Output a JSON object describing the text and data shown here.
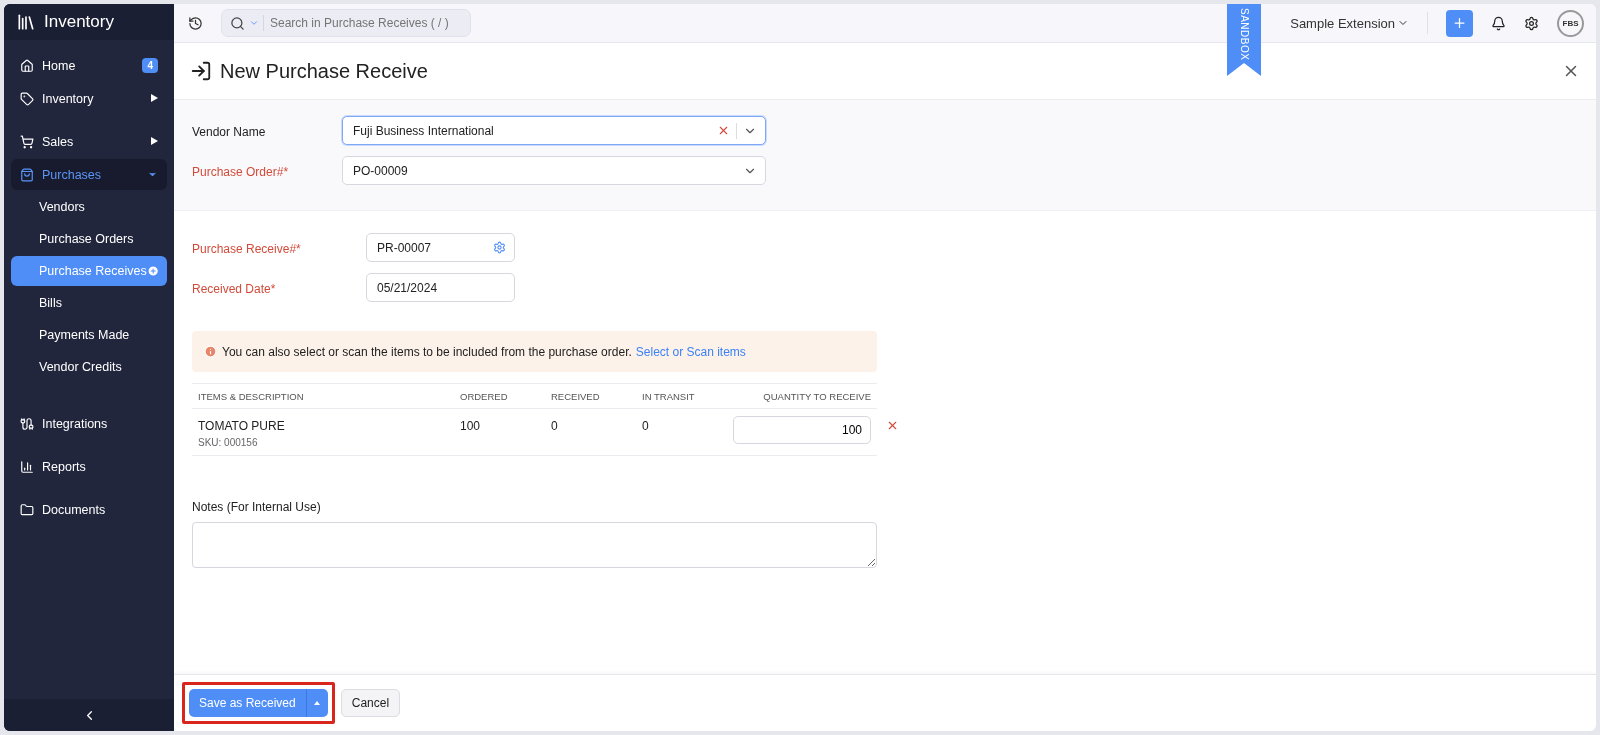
{
  "sidebar": {
    "brand": "Inventory",
    "sections": [
      {
        "items": [
          {
            "label": "Home",
            "badge": "4",
            "selected": false
          },
          {
            "label": "Inventory",
            "expanded": false,
            "selected": false
          }
        ]
      },
      {
        "items": [
          {
            "label": "Sales",
            "expanded": false,
            "selected": false
          },
          {
            "label": "Purchases",
            "expanded": true,
            "selected": true,
            "children": [
              {
                "label": "Vendors",
                "selected": false
              },
              {
                "label": "Purchase Orders",
                "selected": false
              },
              {
                "label": "Purchase Receives",
                "selected": true
              },
              {
                "label": "Bills",
                "selected": false
              },
              {
                "label": "Payments Made",
                "selected": false
              },
              {
                "label": "Vendor Credits",
                "selected": false
              }
            ]
          }
        ]
      },
      {
        "items": [
          {
            "label": "Integrations",
            "selected": false
          }
        ]
      },
      {
        "items": [
          {
            "label": "Reports",
            "selected": false
          }
        ]
      },
      {
        "items": [
          {
            "label": "Documents",
            "selected": false
          }
        ]
      }
    ]
  },
  "topbar": {
    "search": {
      "placeholder": "Search in Purchase Receives ( / )"
    },
    "ribbon": "SANDBOX",
    "organization": "Sample Extension",
    "avatar": "FBS"
  },
  "page": {
    "title": "New Purchase Receive"
  },
  "order_fields": [
    {
      "label": "Vendor Name",
      "value": "Fuji Business International",
      "required": false,
      "focused": true,
      "clearable": true
    },
    {
      "label": "Purchase Order#*",
      "value": "PO-00009",
      "required": true,
      "focused": false,
      "clearable": false
    }
  ],
  "receive_fields": [
    {
      "label": "Purchase Receive#*",
      "value": "PR-00007",
      "required": true,
      "kind": "settings"
    },
    {
      "label": "Received Date*",
      "value": "05/21/2024",
      "required": true,
      "kind": "plain"
    }
  ],
  "notice": {
    "text": "You can also select or scan the items to be included from the purchase order.",
    "link": "Select or Scan items"
  },
  "table": {
    "columns": [
      "ITEMS & DESCRIPTION",
      "ORDERED",
      "RECEIVED",
      "IN TRANSIT",
      "QUANTITY TO RECEIVE"
    ],
    "rows": [
      {
        "item": "TOMATO PURE",
        "sku": "SKU: 000156",
        "ordered": "100",
        "received": "0",
        "in_transit": "0",
        "quantity": "100"
      }
    ]
  },
  "notes": {
    "label": "Notes (For Internal Use)"
  },
  "footer": {
    "primary": "Save as Received",
    "cancel": "Cancel",
    "highlighted": true
  }
}
